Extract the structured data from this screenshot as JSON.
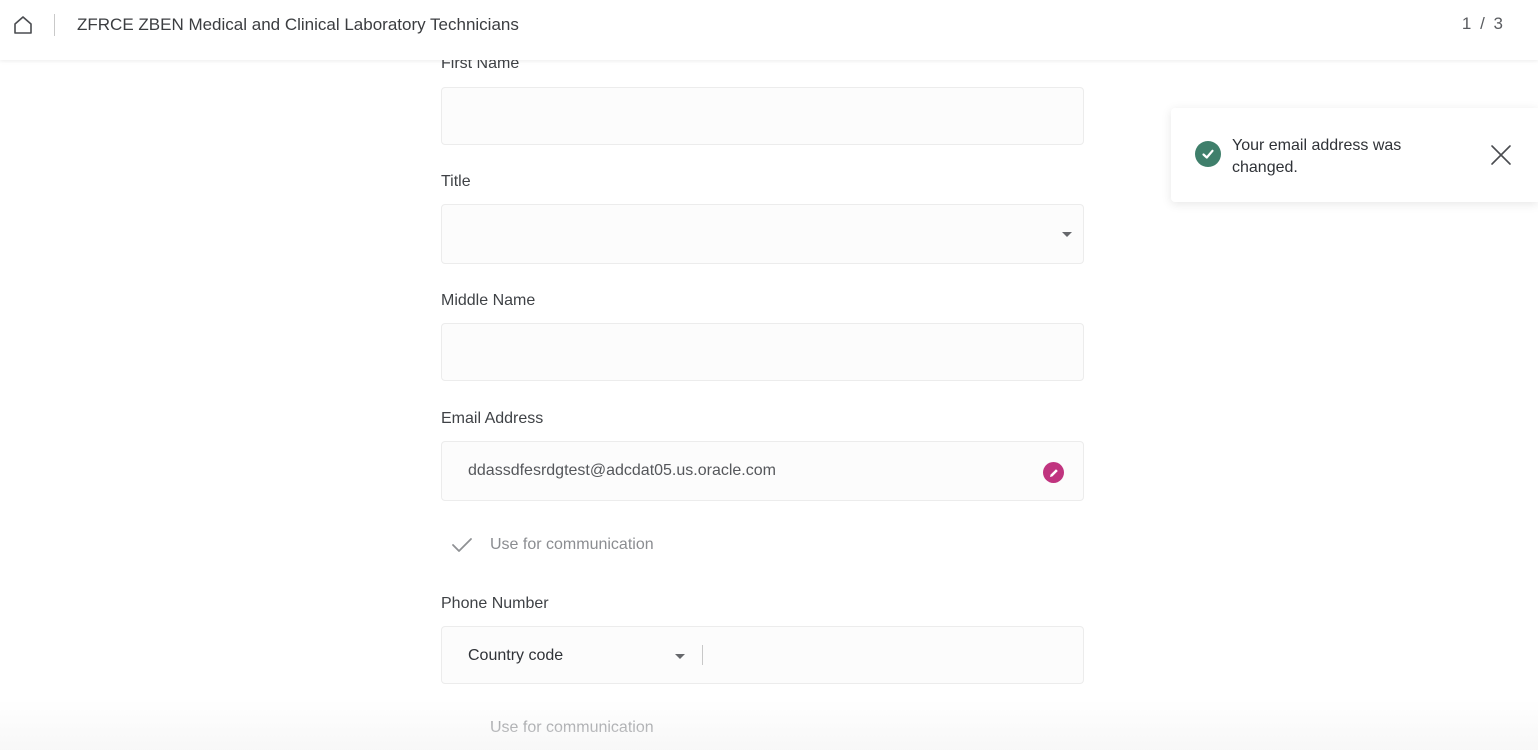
{
  "header": {
    "title": "ZFRCE ZBEN Medical and Clinical Laboratory Technicians",
    "pager": "1 / 3",
    "home_icon": "home-icon"
  },
  "form": {
    "first_name": {
      "label": "First Name",
      "value": ""
    },
    "title": {
      "label": "Title",
      "value": ""
    },
    "middle_name": {
      "label": "Middle Name",
      "value": ""
    },
    "email": {
      "label": "Email Address",
      "value": "ddassdfesrdgtest@adcdat05.us.oracle.com",
      "use_for_communication": {
        "label": "Use for communication",
        "checked": true
      }
    },
    "phone": {
      "label": "Phone Number",
      "country_code_placeholder": "Country code",
      "number": "",
      "use_for_communication": {
        "label": "Use for communication",
        "checked": false
      }
    }
  },
  "toast": {
    "message": "Your email address was changed.",
    "status": "success",
    "icon": "check-circle-icon",
    "close_icon": "close-icon"
  },
  "colors": {
    "accent": "#c0347f",
    "success": "#3f7f6b"
  }
}
